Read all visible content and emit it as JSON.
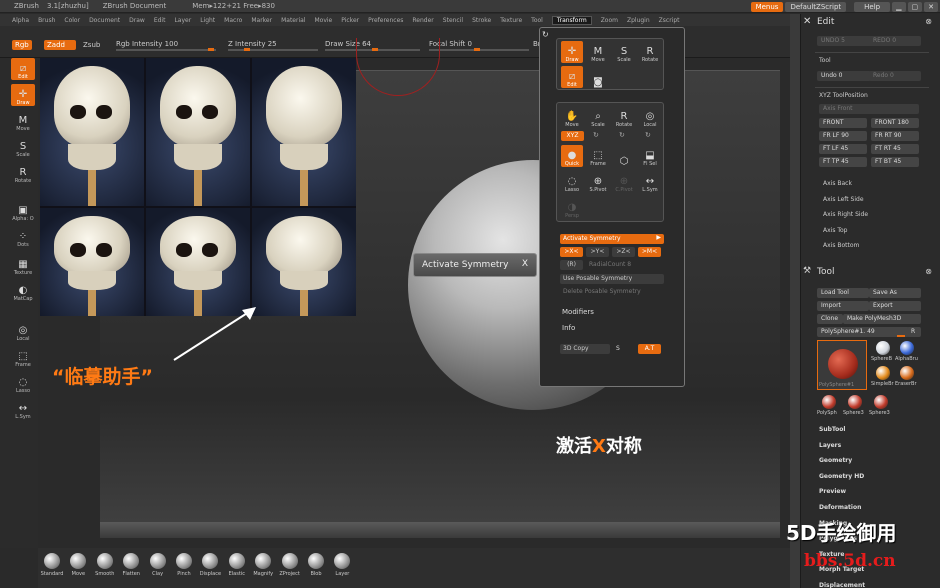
{
  "titlebar": {
    "app": "ZBrush",
    "version": "3.1[zhuzhu]",
    "doc": "ZBrush Document",
    "mem": "Mem▸122+21 Free▸830",
    "menus_btn": "Menus",
    "script_btn": "DefaultZScript",
    "help_btn": "Help"
  },
  "menubar": [
    "Alpha",
    "Brush",
    "Color",
    "Document",
    "Draw",
    "Edit",
    "Layer",
    "Light",
    "Macro",
    "Marker",
    "Material",
    "Movie",
    "Picker",
    "Preferences",
    "Render",
    "Stencil",
    "Stroke",
    "Texture",
    "Tool",
    "Transform",
    "Zoom",
    "Zplugin",
    "Zscript"
  ],
  "menubar_active": "Transform",
  "topbar": {
    "rgb": "Rgb",
    "zadd": "Zadd",
    "zsub": "Zsub",
    "rgb_intensity": "Rgb Intensity 100",
    "z_intensity": "Z Intensity 25",
    "draw_size": "Draw Size 64",
    "focal_shift": "Focal Shift 0",
    "brush": "Brush"
  },
  "leftshelf": [
    {
      "label": "Edit",
      "icon": "edit-icon",
      "active": true
    },
    {
      "label": "Draw",
      "icon": "draw-icon",
      "active": true
    },
    {
      "label": "Move",
      "icon": "move-icon",
      "active": false
    },
    {
      "label": "Scale",
      "icon": "scale-icon",
      "active": false
    },
    {
      "label": "Rotate",
      "icon": "rotate-icon",
      "active": false
    },
    {
      "label": "Alpha: O",
      "icon": "alpha-icon",
      "active": false
    },
    {
      "label": "Dots",
      "icon": "dots-icon",
      "active": false
    },
    {
      "label": "Texture",
      "icon": "texture-icon",
      "active": false
    },
    {
      "label": "MatCap",
      "icon": "matcap-icon",
      "active": false
    },
    {
      "label": "Local",
      "icon": "local-icon",
      "active": false
    },
    {
      "label": "Frame",
      "icon": "frame-icon",
      "active": false
    },
    {
      "label": "Lasso",
      "icon": "lasso-icon",
      "active": false
    },
    {
      "label": "L.Sym",
      "icon": "lsym-icon",
      "active": false
    }
  ],
  "annotation": "“临摹助手”",
  "tooltip": {
    "text": "Activate Symmetry",
    "close": "X"
  },
  "sym_caption": {
    "pre": "激活",
    "x": "X",
    "post": "对称"
  },
  "transform": {
    "row1": [
      {
        "label": "Draw",
        "icon": "draw-icon",
        "state": "orange"
      },
      {
        "label": "Move",
        "icon": "move-icon",
        "state": "normal"
      },
      {
        "label": "Scale",
        "icon": "scale-icon",
        "state": "normal"
      },
      {
        "label": "Rotate",
        "icon": "rotate-icon",
        "state": "normal"
      }
    ],
    "row2": [
      {
        "label": "Edit",
        "icon": "edit-icon",
        "state": "orange"
      },
      {
        "label": "",
        "icon": "camera-icon",
        "state": "normal"
      }
    ],
    "row3": [
      {
        "label": "Move",
        "icon": "hand-icon",
        "state": "normal"
      },
      {
        "label": "Scale",
        "icon": "zoom-icon",
        "state": "normal"
      },
      {
        "label": "Rotate",
        "icon": "rotate-icon",
        "state": "normal"
      },
      {
        "label": "Local",
        "icon": "local-icon",
        "state": "normal"
      }
    ],
    "xyz_label": "XYZ",
    "row4": [
      {
        "label": "Quick",
        "icon": "quick-icon",
        "state": "orange"
      },
      {
        "label": "Frame",
        "icon": "frame-icon",
        "state": "normal"
      },
      {
        "label": "",
        "icon": "cube-icon",
        "state": "normal"
      },
      {
        "label": "Fl Sel",
        "icon": "flsel-icon",
        "state": "normal"
      }
    ],
    "row5": [
      {
        "label": "Lasso",
        "icon": "lasso-icon",
        "state": "normal"
      },
      {
        "label": "S.Pivot",
        "icon": "spivot-icon",
        "state": "normal"
      },
      {
        "label": "C.Pivot",
        "icon": "cpivot-icon",
        "state": "dim"
      },
      {
        "label": "L.Sym",
        "icon": "lsym-icon",
        "state": "normal"
      }
    ],
    "row6": [
      {
        "label": "Persp",
        "icon": "persp-icon",
        "state": "dim"
      }
    ],
    "activate_symmetry": "Activate Symmetry",
    "sym_x": ">X<",
    "sym_y": ">Y<",
    "sym_z": ">Z<",
    "sym_m": ">M<",
    "r_label": "(R)",
    "radial_count": "RadialCount 8",
    "use_poseable": "Use Posable Symmetry",
    "delete_poseable": "Delete Posable Symmetry",
    "modifiers": "Modifiers",
    "info": "Info",
    "copy3d": "3D Copy",
    "s_label": "S",
    "at_label": "A.T"
  },
  "rtray": {
    "edit_title": "Edit",
    "undo_s": "UNDO 5",
    "redo_s": "REDO 0",
    "tool_label": "Tool",
    "undo": "Undo 0",
    "redo": "Redo 0",
    "xyz_pos": "XYZ ToolPosition",
    "axis_front": "Axis Front",
    "views": [
      [
        "FRONT",
        "FRONT 180"
      ],
      [
        "FR LF 90",
        "FR RT 90"
      ],
      [
        "FT LF 45",
        "FT RT 45"
      ],
      [
        "FT TP 45",
        "FT BT 45"
      ]
    ],
    "axes": [
      "Axis Back",
      "Axis Left Side",
      "Axis Right Side",
      "Axis Top",
      "Axis Bottom"
    ],
    "tool_title": "Tool",
    "load_tool": "Load Tool",
    "save_as": "Save As",
    "import": "Import",
    "export": "Export",
    "clone": "Clone",
    "make_poly": "Make PolyMesh3D",
    "poly_sphere": "PolySphere#1. 49",
    "r_btn": "R",
    "thumbs": [
      "PolySphere#1",
      "SphereB",
      "AlphaBru",
      "SimpleBr",
      "EraserBr",
      "PolySph",
      "Sphere3",
      "Sphere3"
    ],
    "subpalettes": [
      "SubTool",
      "Layers",
      "Geometry",
      "Geometry HD",
      "Preview",
      "Deformation",
      "Masking",
      "Polygroups",
      "Texture",
      "Morph Target",
      "Displacement"
    ]
  },
  "bottomshelf": [
    "Standard",
    "Move",
    "Smooth",
    "Flatten",
    "Clay",
    "Pinch",
    "Displace",
    "Elastic",
    "Magnify",
    "ZProject",
    "Blob",
    "Layer"
  ],
  "watermark": {
    "line1": "5D手绘御用",
    "line2": "bbs.5d.cn"
  }
}
